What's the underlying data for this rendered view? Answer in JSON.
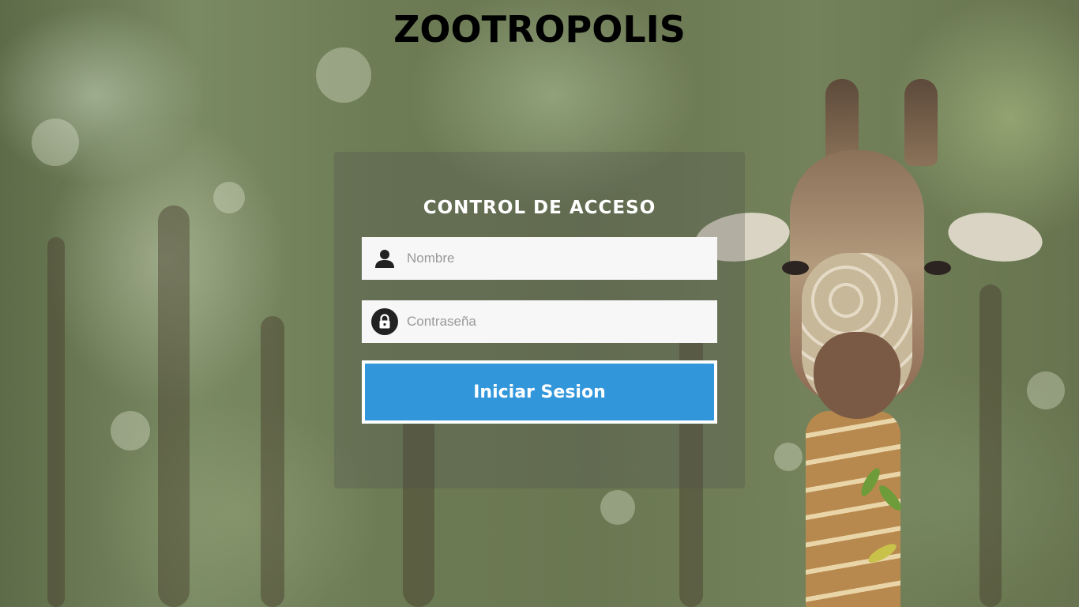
{
  "site_title": "ZOOTROPOLIS",
  "login": {
    "heading": "CONTROL DE ACCESO",
    "username": {
      "placeholder": "Nombre",
      "value": "",
      "icon": "user-icon"
    },
    "password": {
      "placeholder": "Contraseña",
      "value": "",
      "icon": "lock-icon"
    },
    "submit_label": "Iniciar Sesion"
  },
  "colors": {
    "button": "#3296db",
    "panel": "rgba(80,80,80,0.28)",
    "title": "#000000"
  }
}
